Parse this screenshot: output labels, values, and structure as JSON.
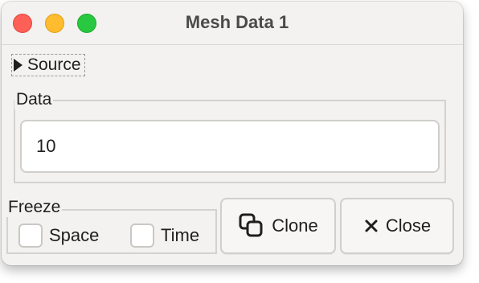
{
  "window": {
    "title": "Mesh Data 1"
  },
  "source": {
    "label": "Source",
    "expanded": false
  },
  "data_group": {
    "label": "Data",
    "value": "10"
  },
  "freeze_group": {
    "label": "Freeze",
    "space_label": "Space",
    "space_checked": false,
    "time_label": "Time",
    "time_checked": false
  },
  "buttons": {
    "clone_label": "Clone",
    "clone_icon": "clone-icon",
    "close_label": "Close",
    "close_icon": "x-icon"
  },
  "colors": {
    "close_light": "#fe5f57",
    "minimize_light": "#febc2e",
    "maximize_light": "#28c840"
  }
}
